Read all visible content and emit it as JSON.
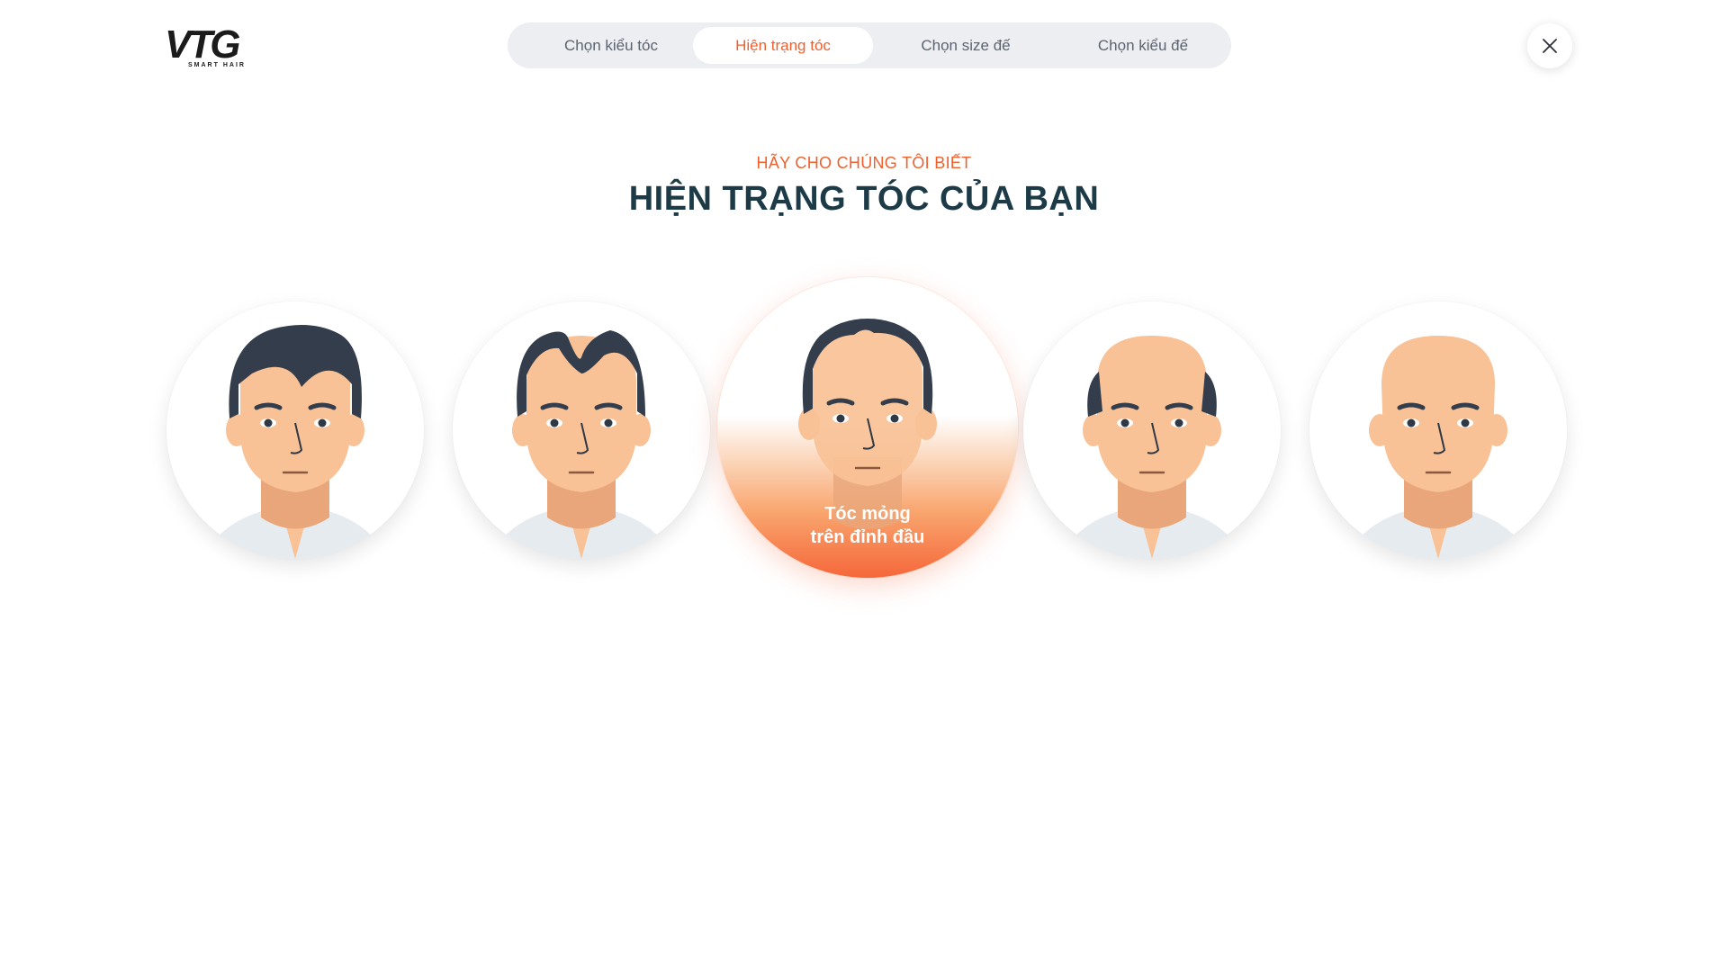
{
  "app": {
    "logo_text": "VTG",
    "logo_tagline": "SMART HAIR"
  },
  "steps": [
    {
      "label": "Chọn kiểu tóc",
      "active": false
    },
    {
      "label": "Hiện trạng tóc",
      "active": true
    },
    {
      "label": "Chọn size đế",
      "active": false
    },
    {
      "label": "Chọn kiểu đế",
      "active": false
    }
  ],
  "close_icon": "close-icon",
  "header": {
    "subtitle": "HÃY CHO CHÚNG TÔI BIẾT",
    "title": "HIỆN TRẠNG TÓC CỦA BẠN"
  },
  "options": [
    {
      "icon": "full-hair-face-icon",
      "selected": false
    },
    {
      "icon": "receding-hairline-face-icon",
      "selected": false
    },
    {
      "icon": "thinning-crown-face-icon",
      "selected": true,
      "label_line1": "Tóc mỏng",
      "label_line2": "trên đỉnh đầu"
    },
    {
      "icon": "balding-top-face-icon",
      "selected": false
    },
    {
      "icon": "fully-bald-face-icon",
      "selected": false
    }
  ],
  "colors": {
    "accent": "#f0602d",
    "title": "#1d3a47",
    "stepper_bg": "#eceef1",
    "skin": "#f8c196",
    "hair": "#333d4b",
    "shirt": "#e6ebf0"
  }
}
